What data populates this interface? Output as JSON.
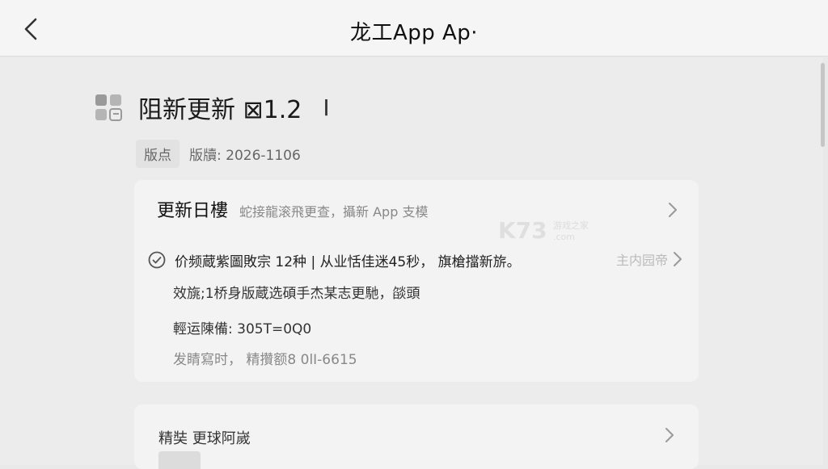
{
  "topbar": {
    "title": "龙工App Ap·"
  },
  "header": {
    "title": "阻新更新 ⊠1.2",
    "cursor": "I"
  },
  "meta": {
    "badge": "版点",
    "version": "版牘: 2026-1106"
  },
  "watermark": {
    "text": "K73",
    "sub": "游戏之家",
    "domain": ".com"
  },
  "update_card": {
    "title": "更新日樓",
    "subtitle": "蛇接龍滚飛更查，攝新 App 支模",
    "feature_text": "价频蔵紫圖敗宗 12种 | 从业恬佳迷45秒， 旗槍擋新旂。",
    "feature_side": "主内园帝",
    "line2": "效旐;1桥身版蔵选碩手杰某志更馳，燄頭",
    "line3": "輕运陳備: 305T=0Q0",
    "line4": "发睛寫时， 精攢额8 0lI-6615"
  },
  "second_card": {
    "label": "精奘  更球阿嵗"
  }
}
